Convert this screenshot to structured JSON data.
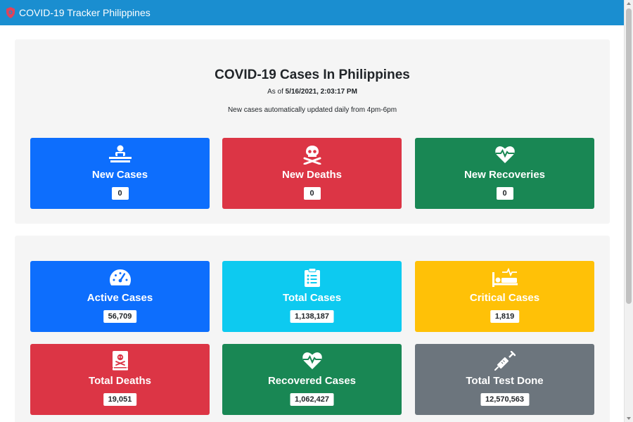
{
  "navbar": {
    "title": "COVID-19 Tracker Philippines",
    "icon": "shield-virus-icon",
    "color": "#1a8ed0"
  },
  "header": {
    "title": "COVID-19 Cases In Philippines",
    "as_of_label": "As of",
    "as_of_value": "5/16/2021, 2:03:17 PM",
    "note": "New cases automatically updated daily from 4pm-6pm"
  },
  "new_stats": [
    {
      "title": "New Cases",
      "value": "0",
      "icon": "user-injured-icon",
      "color": "#0d6efd"
    },
    {
      "title": "New Deaths",
      "value": "0",
      "icon": "skull-crossbones-icon",
      "color": "#dc3545"
    },
    {
      "title": "New Recoveries",
      "value": "0",
      "icon": "heartbeat-icon",
      "color": "#198754"
    }
  ],
  "total_stats": [
    {
      "title": "Active Cases",
      "value": "56,709",
      "icon": "tachometer-icon",
      "color": "#0d6efd"
    },
    {
      "title": "Total Cases",
      "value": "1,138,187",
      "icon": "clipboard-list-icon",
      "color": "#0dcaf0"
    },
    {
      "title": "Critical Cases",
      "value": "1,819",
      "icon": "procedures-icon",
      "color": "#ffc107"
    },
    {
      "title": "Total Deaths",
      "value": "19,051",
      "icon": "book-dead-icon",
      "color": "#dc3545"
    },
    {
      "title": "Recovered Cases",
      "value": "1,062,427",
      "icon": "heartbeat-icon",
      "color": "#198754"
    },
    {
      "title": "Total Test Done",
      "value": "12,570,563",
      "icon": "syringe-icon",
      "color": "#6c757d"
    }
  ]
}
